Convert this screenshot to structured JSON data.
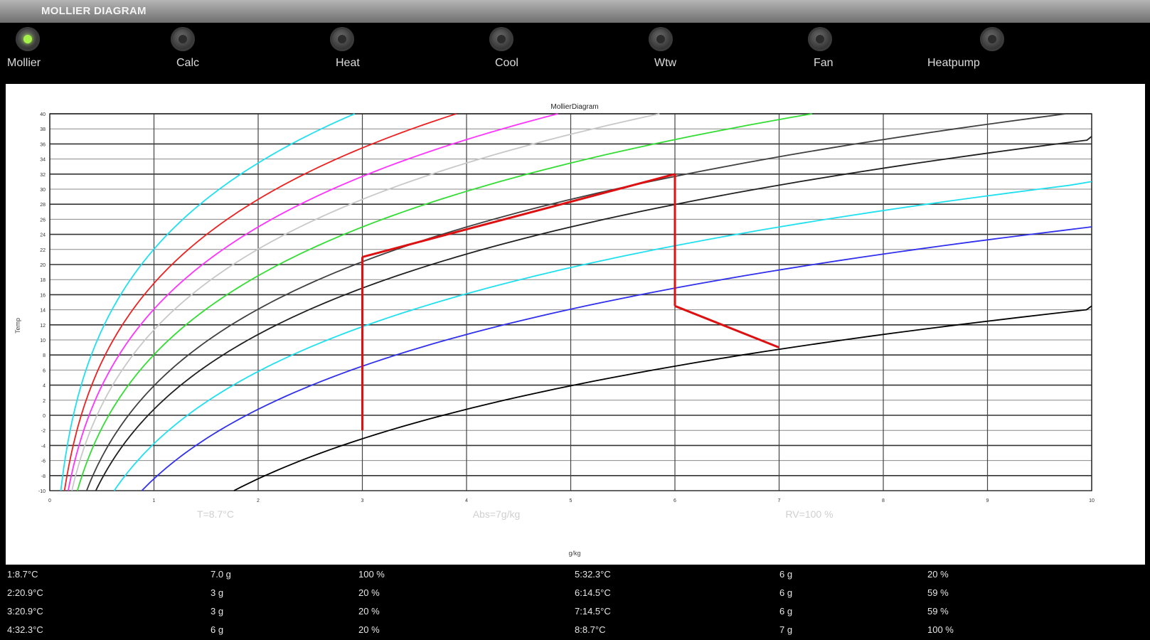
{
  "app": {
    "title": "MOLLIER DIAGRAM"
  },
  "tabs": [
    {
      "label": "Mollier",
      "active": true
    },
    {
      "label": "Calc",
      "active": false
    },
    {
      "label": "Heat",
      "active": false
    },
    {
      "label": "Cool",
      "active": false
    },
    {
      "label": "Wtw",
      "active": false
    },
    {
      "label": "Fan",
      "active": false
    },
    {
      "label": "Heatpump",
      "active": false
    }
  ],
  "readouts": {
    "temperature": "T=8.7°C",
    "absolute": "Abs=7g/kg",
    "relative": "RV=100 %"
  },
  "chart_data": {
    "type": "line",
    "title": "MollierDiagram",
    "xlabel": "g/kg",
    "ylabel": "Temp",
    "xlim": [
      0,
      10
    ],
    "ylim": [
      -10,
      40
    ],
    "y_ticks": [
      -10,
      -8,
      -6,
      -4,
      -2,
      0,
      2,
      4,
      6,
      8,
      10,
      12,
      14,
      16,
      18,
      20,
      22,
      24,
      26,
      28,
      30,
      32,
      34,
      36,
      38,
      40
    ],
    "x_ticks": [
      0,
      1,
      2,
      3,
      4,
      5,
      6,
      7,
      8,
      9,
      10
    ],
    "grid": true,
    "rh_curves": [
      {
        "rh": 100,
        "color": "#000000"
      },
      {
        "rh": 50,
        "color": "#3030ee"
      },
      {
        "rh": 35,
        "color": "#20e0f0"
      },
      {
        "rh": 25,
        "color": "#202020"
      },
      {
        "rh": 20,
        "color": "#404040"
      },
      {
        "rh": 15,
        "color": "#33dd33"
      },
      {
        "rh": 12,
        "color": "#c8c8c8"
      },
      {
        "rh": 10,
        "color": "#ff33ff"
      },
      {
        "rh": 8,
        "color": "#ee2020"
      },
      {
        "rh": 6,
        "color": "#20e0f0"
      }
    ],
    "process": {
      "color": "#dd1111",
      "points": [
        {
          "x": 3,
          "y": -2
        },
        {
          "x": 3,
          "y": 21
        },
        {
          "x": 6,
          "y": 32
        },
        {
          "x": 6,
          "y": 14.5
        },
        {
          "x": 7,
          "y": 9
        }
      ]
    }
  },
  "table": {
    "rows": [
      [
        "1:8.7°C",
        "7.0 g",
        "100 %",
        "5:32.3°C",
        "6 g",
        "20 %"
      ],
      [
        "2:20.9°C",
        "3 g",
        "20 %",
        "6:14.5°C",
        "6 g",
        "59 %"
      ],
      [
        "3:20.9°C",
        "3 g",
        "20 %",
        "7:14.5°C",
        "6 g",
        "59 %"
      ],
      [
        "4:32.3°C",
        "6 g",
        "20 %",
        "8:8.7°C",
        "7 g",
        "100 %"
      ]
    ]
  }
}
